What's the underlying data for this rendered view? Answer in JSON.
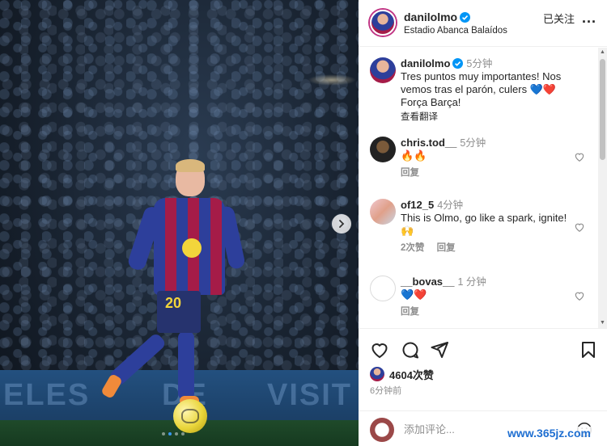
{
  "post": {
    "author": "danilolmo",
    "location": "Estadio Abanca Balaídos",
    "follow_status": "已关注",
    "more_label": "...",
    "caption": {
      "username": "danilolmo",
      "time": "5分钟",
      "text": "Tres puntos muy importantes! Nos vemos tras el parón, culers 💙❤️ Força Barça!",
      "see_translation": "查看翻译"
    },
    "comments": [
      {
        "username": "chris.tod__",
        "time": "5分钟",
        "text": "🔥🔥",
        "reply_label": "回复",
        "likes": ""
      },
      {
        "username": "of12_5",
        "time": "4分钟",
        "text": "This is Olmo, go like a spark, ignite!🙌",
        "likes": "2次赞",
        "reply_label": "回复"
      },
      {
        "username": "__bovas__",
        "time": "1 分钟",
        "text": "💙❤️",
        "reply_label": "回复",
        "likes": ""
      }
    ],
    "like_count": "4604次赞",
    "posted_ago": "6分钟前",
    "add_comment_placeholder": "添加评论...",
    "carousel": {
      "total": 4,
      "active_index": 1
    }
  },
  "image": {
    "shirt_number": "20",
    "board_text": [
      "ELES",
      "DE",
      "VISIT"
    ]
  },
  "watermark": "www.365jz.com",
  "colors": {
    "link_blue": "#0095f6",
    "verified": "#0095f6",
    "secondary_text": "#8e8e8e"
  },
  "icons": [
    "verified-badge-icon",
    "chevron-right-icon",
    "heart-icon",
    "comment-icon",
    "share-icon",
    "bookmark-icon",
    "emoji-icon"
  ]
}
